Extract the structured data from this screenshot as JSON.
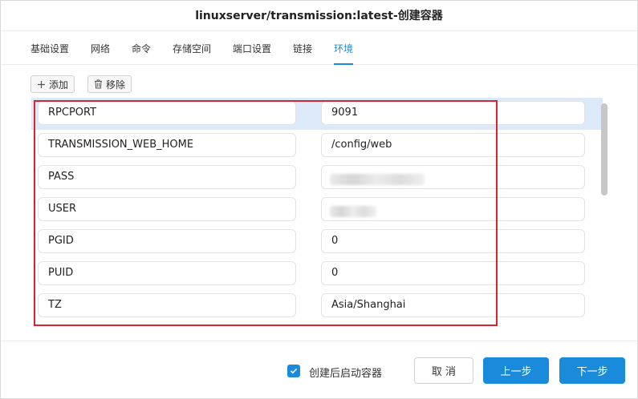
{
  "dialog": {
    "title": "linuxserver/transmission:latest-创建容器"
  },
  "tabs": [
    {
      "label": "基础设置",
      "active": false
    },
    {
      "label": "网络",
      "active": false
    },
    {
      "label": "命令",
      "active": false
    },
    {
      "label": "存储空间",
      "active": false
    },
    {
      "label": "端口设置",
      "active": false
    },
    {
      "label": "链接",
      "active": false
    },
    {
      "label": "环境",
      "active": true
    }
  ],
  "toolbar": {
    "add_label": "添加",
    "add_icon": "plus-icon",
    "remove_label": "移除",
    "remove_icon": "trash-icon"
  },
  "env_vars": [
    {
      "key": "RPCPORT",
      "value": "9091",
      "selected": true,
      "redacted": false
    },
    {
      "key": "TRANSMISSION_WEB_HOME",
      "value": "/config/web",
      "selected": false,
      "redacted": false
    },
    {
      "key": "PASS",
      "value": "",
      "selected": false,
      "redacted": true
    },
    {
      "key": "USER",
      "value": "",
      "selected": false,
      "redacted": true
    },
    {
      "key": "PGID",
      "value": "0",
      "selected": false,
      "redacted": false
    },
    {
      "key": "PUID",
      "value": "0",
      "selected": false,
      "redacted": false
    },
    {
      "key": "TZ",
      "value": "Asia/Shanghai",
      "selected": false,
      "redacted": false
    }
  ],
  "footer": {
    "checkbox_label": "创建后启动容器",
    "checkbox_checked": true,
    "cancel_label": "取 消",
    "prev_label": "上一步",
    "next_label": "下一步"
  },
  "colors": {
    "accent": "#1a8bdb",
    "selected_row": "#dbe9f8",
    "highlight_border": "#d9252f"
  }
}
